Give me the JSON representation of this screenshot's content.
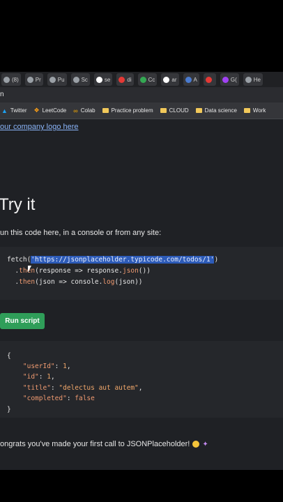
{
  "tabs": [
    {
      "label": "(8)",
      "icon": "tab-icon",
      "color": "#9aa0a6"
    },
    {
      "label": "Pr",
      "icon": "tab-icon",
      "color": "#9aa0a6"
    },
    {
      "label": "Pu",
      "icon": "tab-icon",
      "color": "#9aa0a6"
    },
    {
      "label": "Sc",
      "icon": "tab-icon",
      "color": "#9aa0a6"
    },
    {
      "label": "se",
      "icon": "google-icon",
      "color": "#ffffff"
    },
    {
      "label": "di",
      "icon": "youtube-icon",
      "color": "#e53935"
    },
    {
      "label": "Cc",
      "icon": "tab-icon",
      "color": "#34a853"
    },
    {
      "label": "ar",
      "icon": "google-icon",
      "color": "#ffffff"
    },
    {
      "label": "A",
      "icon": "tab-icon",
      "color": "#4a7bd0"
    },
    {
      "label": "",
      "icon": "youtube-icon",
      "color": "#e53935"
    },
    {
      "label": "G(",
      "icon": "tab-icon",
      "color": "#a142f4"
    },
    {
      "label": "He",
      "icon": "tab-icon",
      "color": "#9aa0a6"
    }
  ],
  "address_bar": {
    "text": "n"
  },
  "bookmarks": [
    {
      "label": "Twitter",
      "icon": "twitter-icon"
    },
    {
      "label": "LeetCode",
      "icon": "leetcode-icon"
    },
    {
      "label": "Colab",
      "icon": "colab-icon"
    },
    {
      "label": "Practice problem",
      "icon": "folder-icon"
    },
    {
      "label": "CLOUD",
      "icon": "folder-icon"
    },
    {
      "label": "Data science",
      "icon": "folder-icon"
    },
    {
      "label": "Work",
      "icon": "folder-icon"
    }
  ],
  "page": {
    "logo_link": "our company logo here",
    "heading": "Try it",
    "lead": "un this code here, in a console or from any site:",
    "code_request": {
      "line1_prefix": "fetch(",
      "line1_url": "'https://jsonplaceholder.typicode.com/todos/1'",
      "line1_suffix": ")",
      "line2_prefix": "  .",
      "line2_kw": "then",
      "line2_rest": "(response => response.",
      "line2_kw2": "json",
      "line2_end": "())",
      "line3_prefix": "  .",
      "line3_kw": "then",
      "line3_rest": "(json => console.",
      "line3_kw2": "log",
      "line3_end": "(json))"
    },
    "run_button": "Run script",
    "code_response": {
      "open": "{",
      "k1": "\"userId\"",
      "v1": "1",
      "k2": "\"id\"",
      "v2": "1",
      "k3": "\"title\"",
      "v3": "\"delectus aut autem\"",
      "k4": "\"completed\"",
      "v4": "false",
      "close": "}"
    },
    "congrats": "ongrats you've made your first call to JSONPlaceholder!"
  }
}
